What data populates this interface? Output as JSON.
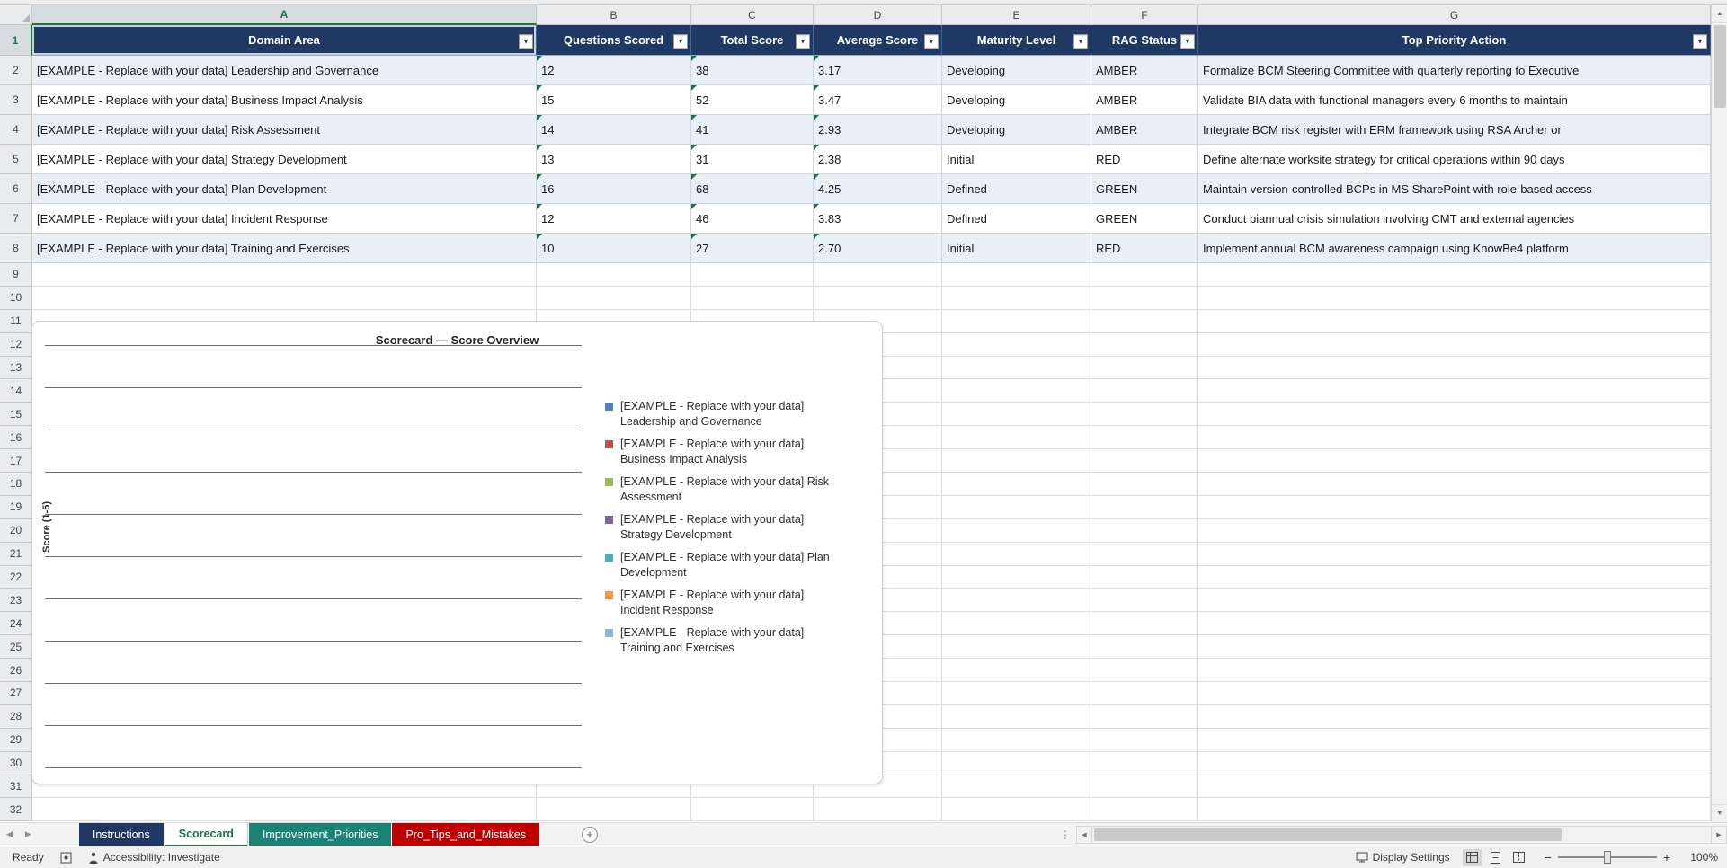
{
  "grid": {
    "column_letters": [
      "A",
      "B",
      "C",
      "D",
      "E",
      "F",
      "G"
    ],
    "row_numbers": [
      "1",
      "2",
      "3",
      "4",
      "5",
      "6",
      "7",
      "8",
      "9",
      "10",
      "11",
      "12",
      "13",
      "14",
      "15",
      "16",
      "17",
      "18",
      "19",
      "20",
      "21",
      "22",
      "23",
      "24",
      "25",
      "26",
      "27",
      "28",
      "29",
      "30",
      "31",
      "32"
    ],
    "selected_column": "A",
    "selected_row": "1"
  },
  "table": {
    "headers": [
      "Domain Area",
      "Questions Scored",
      "Total Score",
      "Average Score",
      "Maturity Level",
      "RAG Status",
      "Top Priority Action"
    ],
    "rows": [
      [
        "[EXAMPLE - Replace with your data] Leadership and Governance",
        "12",
        "38",
        "3.17",
        "Developing",
        "AMBER",
        "Formalize BCM Steering Committee with quarterly reporting to Executive"
      ],
      [
        "[EXAMPLE - Replace with your data] Business Impact Analysis",
        "15",
        "52",
        "3.47",
        "Developing",
        "AMBER",
        "Validate BIA data with functional managers every 6 months to maintain"
      ],
      [
        "[EXAMPLE - Replace with your data] Risk Assessment",
        "14",
        "41",
        "2.93",
        "Developing",
        "AMBER",
        "Integrate BCM risk register with ERM framework using RSA Archer or"
      ],
      [
        "[EXAMPLE - Replace with your data] Strategy Development",
        "13",
        "31",
        "2.38",
        "Initial",
        "RED",
        "Define alternate worksite strategy for critical operations within 90 days"
      ],
      [
        "[EXAMPLE - Replace with your data] Plan Development",
        "16",
        "68",
        "4.25",
        "Defined",
        "GREEN",
        "Maintain version-controlled BCPs in MS SharePoint with role-based access"
      ],
      [
        "[EXAMPLE - Replace with your data] Incident Response",
        "12",
        "46",
        "3.83",
        "Defined",
        "GREEN",
        "Conduct biannual crisis simulation involving CMT and external agencies"
      ],
      [
        "[EXAMPLE - Replace with your data] Training and Exercises",
        "10",
        "27",
        "2.70",
        "Initial",
        "RED",
        "Implement annual BCM awareness campaign using KnowBe4 platform"
      ]
    ]
  },
  "chart_data": {
    "type": "bar",
    "title": "Scorecard — Score Overview",
    "ylabel": "Score (1-5)",
    "xlabel": "",
    "gridlines": true,
    "legend_position": "right",
    "axis_tick_labels_visible": false,
    "plotted_values_visible": false,
    "series": [
      {
        "name": "[EXAMPLE - Replace with your data] Leadership and Governance",
        "color": "#4F81BD"
      },
      {
        "name": "[EXAMPLE - Replace with your data] Business Impact Analysis",
        "color": "#C0504D"
      },
      {
        "name": "[EXAMPLE - Replace with your data] Risk Assessment",
        "color": "#9BBB59"
      },
      {
        "name": "[EXAMPLE - Replace with your data] Strategy Development",
        "color": "#8064A2"
      },
      {
        "name": "[EXAMPLE - Replace with your data] Plan Development",
        "color": "#4BACC6"
      },
      {
        "name": "[EXAMPLE - Replace with your data] Incident Response",
        "color": "#F79646"
      },
      {
        "name": "[EXAMPLE - Replace with your data] Training and Exercises",
        "color": "#95B3D7"
      }
    ]
  },
  "sheet_tabs": {
    "items": [
      {
        "label": "Instructions",
        "bg": "#1F3864",
        "fg": "#FFFFFF",
        "active": false
      },
      {
        "label": "Scorecard",
        "bg": "#FFFFFF",
        "fg": "#1E7145",
        "active": true
      },
      {
        "label": "Improvement_Priorities",
        "bg": "#1B8276",
        "fg": "#FFFFFF",
        "active": false
      },
      {
        "label": "Pro_Tips_and_Mistakes",
        "bg": "#C00000",
        "fg": "#FFFFFF",
        "active": false
      }
    ],
    "add_sheet": "+"
  },
  "status_bar": {
    "mode": "Ready",
    "accessibility": "Accessibility: Investigate",
    "display_settings": "Display Settings",
    "zoom_out": "−",
    "zoom_in": "+",
    "zoom_level": "100%"
  },
  "icons": {
    "filter_dropdown": "▼",
    "scroll_up": "▲",
    "scroll_down": "▼",
    "scroll_left": "◀",
    "scroll_right": "▶",
    "tab_nav_left": "◀",
    "tab_nav_right": "▶",
    "overflow_dots": "⋮"
  },
  "colors": {
    "table_header_fill": "#1F3864",
    "accent_green": "#1E7145",
    "band_fill": "#E9EFF7",
    "error_indicator_green": "#1E7145"
  }
}
